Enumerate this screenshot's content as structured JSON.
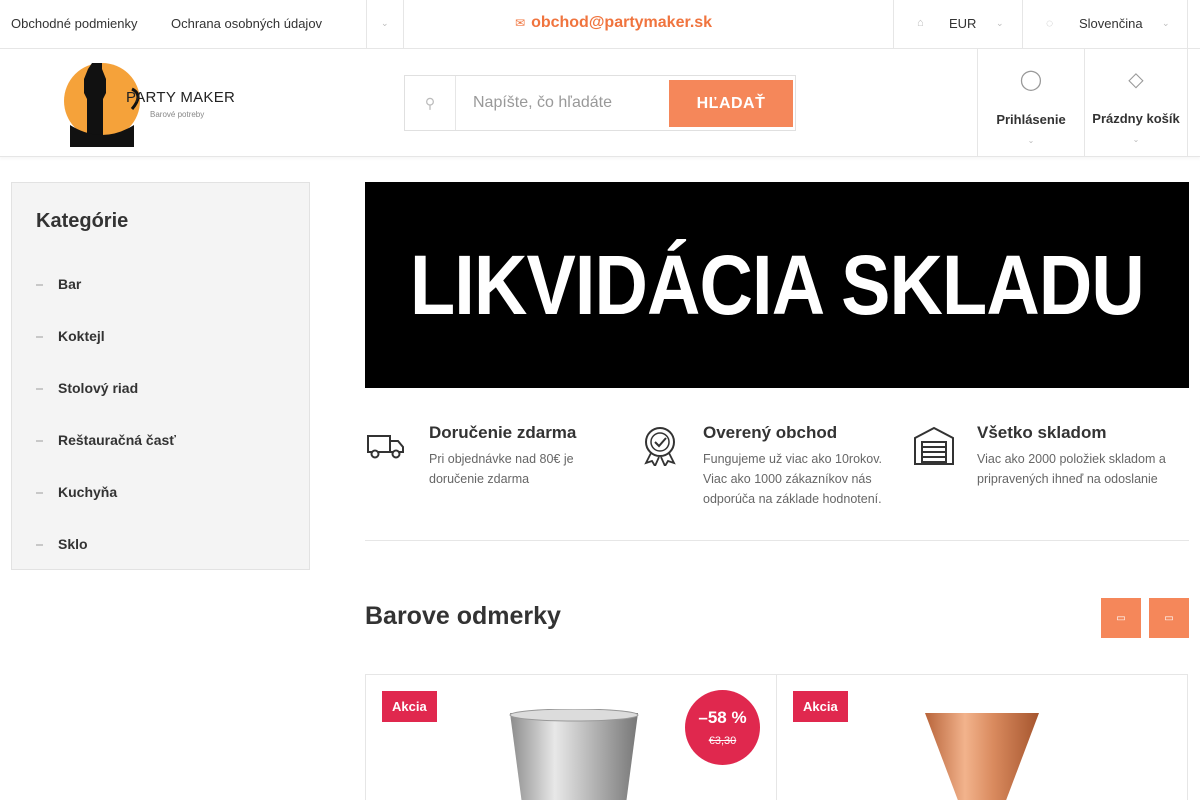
{
  "topbar": {
    "links": [
      "Obchodné podmienky",
      "Ochrana osobných údajov"
    ],
    "menu_chevron": "⌄",
    "email_icon": "envelope-icon",
    "email": "obchod@partymaker.sk",
    "currency": "EUR",
    "language": "Slovenčina"
  },
  "header": {
    "logo": {
      "brand": "PARTY MAKER",
      "tagline": "Barové potreby"
    },
    "search": {
      "placeholder": "Napíšte, čo hľadáte",
      "button": "HĽADAŤ"
    },
    "login_label": "Prihlásenie",
    "cart_label": "Prázdny košík"
  },
  "sidebar": {
    "title": "Kategórie",
    "categories": [
      "Bar",
      "Koktejl",
      "Stolový riad",
      "Reštauračná časť",
      "Kuchyňa",
      "Sklo"
    ]
  },
  "banner": {
    "text": "LIKVIDÁCIA SKLADU"
  },
  "benefits": [
    {
      "icon": "truck-icon",
      "title": "Doručenie zdarma",
      "text": "Pri objednávke nad 80€ je doručenie zdarma"
    },
    {
      "icon": "badge-check-icon",
      "title": "Overený obchod",
      "text": "Fungujeme už viac ako 10rokov. Viac ako 1000 zákazníkov nás odporúča na základe hodnotení."
    },
    {
      "icon": "warehouse-icon",
      "title": "Všetko skladom",
      "text": "Viac ako 2000 položiek skladom a pripravených ihneď na odoslanie"
    }
  ],
  "section": {
    "title": "Barove odmerky",
    "prev_glyph": "▭",
    "next_glyph": "▭"
  },
  "products": [
    {
      "badge": "Akcia",
      "discount": "–58 %",
      "old_price": "€3,30",
      "image": "steel-jigger"
    },
    {
      "badge": "Akcia",
      "image": "copper-jigger"
    }
  ],
  "colors": {
    "accent": "#f5875a",
    "email": "#f0743e",
    "sale": "#e0284e",
    "sidebar_bg": "#f4f4f4"
  }
}
